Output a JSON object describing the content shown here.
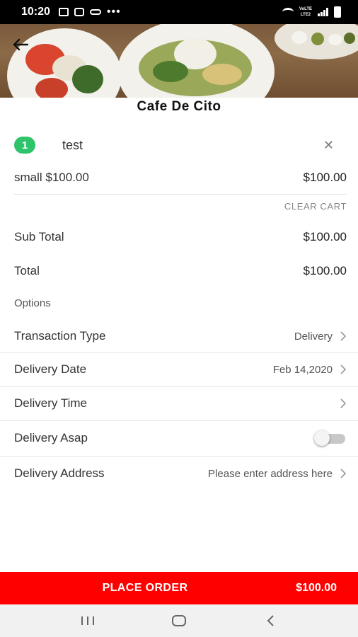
{
  "status_bar": {
    "time": "10:20",
    "dots": "•••",
    "network_label_top": "VoLTE",
    "network_label_bottom": "LTE2"
  },
  "restaurant": {
    "name": "Cafe De Cito"
  },
  "cart": {
    "item": {
      "quantity": "1",
      "name": "test",
      "remove_icon": "✕"
    },
    "variant": {
      "label": "small $100.00",
      "price": "$100.00"
    },
    "clear_label": "CLEAR CART",
    "sub_total_label": "Sub Total",
    "sub_total_value": "$100.00",
    "total_label": "Total",
    "total_value": "$100.00"
  },
  "options": {
    "section_label": "Options",
    "transaction_type": {
      "label": "Transaction Type",
      "value": "Delivery"
    },
    "delivery_date": {
      "label": "Delivery Date",
      "value": "Feb 14,2020"
    },
    "delivery_time": {
      "label": "Delivery Time",
      "value": ""
    },
    "delivery_asap": {
      "label": "Delivery Asap",
      "enabled": false
    },
    "delivery_address": {
      "label": "Delivery Address",
      "placeholder": "Please enter address here"
    }
  },
  "place_order": {
    "label": "PLACE ORDER",
    "amount": "$100.00"
  },
  "colors": {
    "accent_red": "#ff0000",
    "badge_green": "#2fc36b"
  }
}
